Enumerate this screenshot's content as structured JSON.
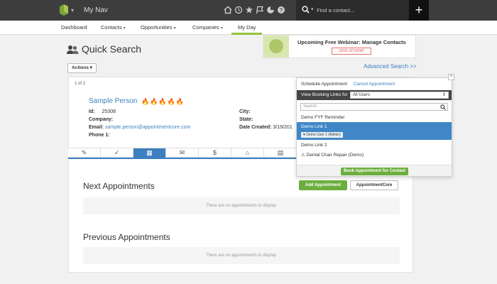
{
  "topbar": {
    "nav_name": "My Nav",
    "search_placeholder": "Find a contact...",
    "plus_label": "+",
    "icons": [
      "home-icon",
      "history-icon",
      "star-icon",
      "flag-icon",
      "pie-chart-icon",
      "help-icon"
    ]
  },
  "subnav": {
    "items": [
      {
        "label": "Dashboard"
      },
      {
        "label": "Contacts"
      },
      {
        "label": "Opportunities"
      },
      {
        "label": "Companies"
      },
      {
        "label": "My Day"
      }
    ],
    "active": "My Day"
  },
  "page": {
    "title": "Quick Search",
    "actions_label": "Actions",
    "advanced_search": "Advanced Search >>"
  },
  "webinar": {
    "text": "Upcoming Free Webinar: Manage Contacts",
    "button": "SIGN UP NOW!"
  },
  "result": {
    "count": "1 of 1",
    "name": "Sample Person",
    "id_label": "Id:",
    "id_value": "25308",
    "company_label": "Company:",
    "email_label": "Email:",
    "email_value": "sample.person@appointmentcore.com",
    "phone_label": "Phone 1:",
    "city_label": "City:",
    "state_label": "State:",
    "date_label": "Date Created:",
    "date_value": "3/19/201"
  },
  "tabs": [
    "edit-icon",
    "check-icon",
    "calendar-icon",
    "mail-icon",
    "dollar-icon",
    "tag-icon",
    "document-icon"
  ],
  "appointments": {
    "next_title": "Next Appointments",
    "previous_title": "Previous Appointments",
    "empty_text": "There are no appointments to display.",
    "add_button": "Add Appointment",
    "core_button": "AppointmentCore"
  },
  "popup": {
    "tab_schedule": "Schedule Appointment",
    "tab_cancel": "Cancel Appointment",
    "view_label": "View Booking Links for",
    "select_value": "All Users",
    "search_placeholder": "Search",
    "items": [
      {
        "label": "Demo FYF Reminder"
      },
      {
        "label": "Demo Link 1",
        "badge": "Demo User 1 (Admin)"
      },
      {
        "label": "Demo Link 2"
      },
      {
        "label": "Dental Chair Repair (Demo)"
      }
    ],
    "book_button": "Book Appointment for Contact",
    "close": "×"
  },
  "colors": {
    "accent_blue": "#3d7fc1",
    "green": "#6cae3e",
    "topbar": "#3d3d3d"
  }
}
